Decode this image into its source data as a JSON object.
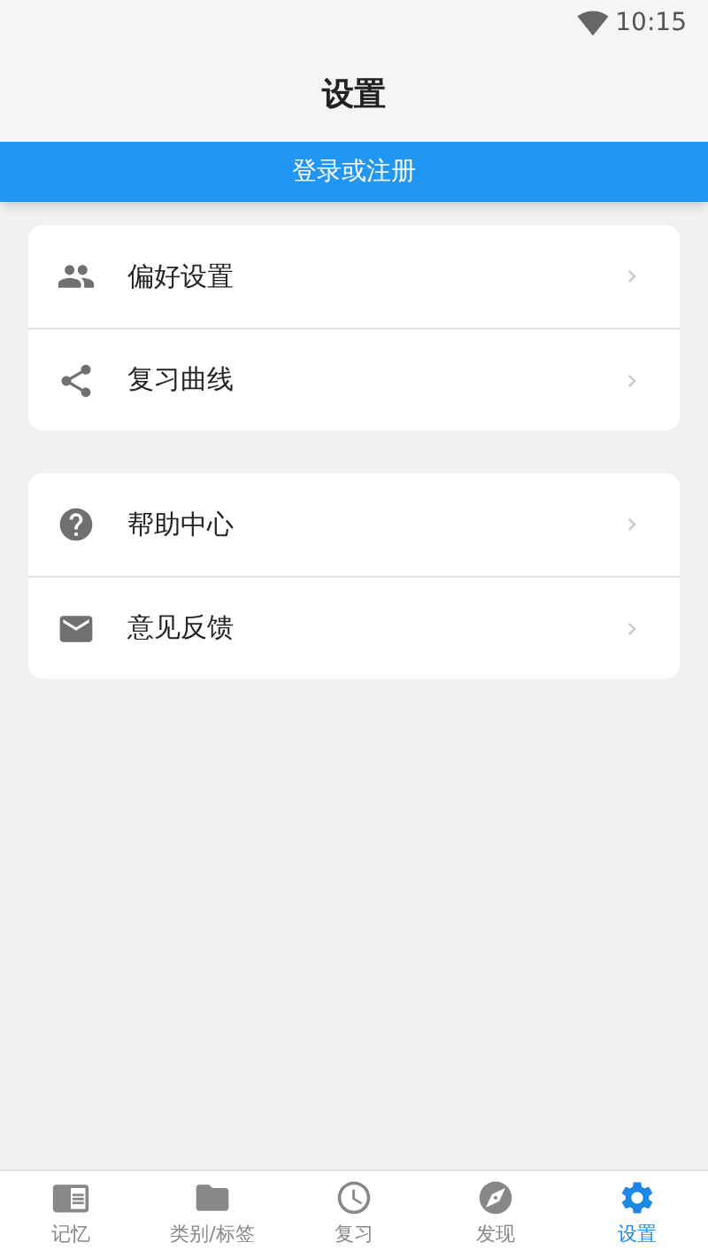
{
  "status_bar": {
    "time": "10:15"
  },
  "header": {
    "title": "设置"
  },
  "login_button": {
    "label": "登录或注册"
  },
  "groups": [
    {
      "items": [
        {
          "label": "偏好设置"
        },
        {
          "label": "复习曲线"
        }
      ]
    },
    {
      "items": [
        {
          "label": "帮助中心"
        },
        {
          "label": "意见反馈"
        }
      ]
    }
  ],
  "tabs": [
    {
      "label": "记忆",
      "selected": false
    },
    {
      "label": "类别/标签",
      "selected": false
    },
    {
      "label": "复习",
      "selected": false
    },
    {
      "label": "发现",
      "selected": false
    },
    {
      "label": "设置",
      "selected": true
    }
  ]
}
